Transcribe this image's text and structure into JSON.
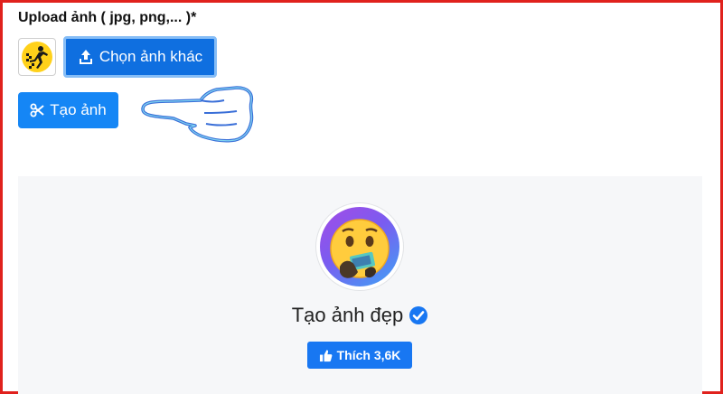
{
  "upload": {
    "label": "Upload ảnh ( jpg, png,... )*",
    "choose_button_label": "Chọn ảnh khác",
    "create_button_label": "Tạo ảnh"
  },
  "preview": {
    "title": "Tạo ảnh đẹp",
    "like_button_label": "Thích 3,6K"
  },
  "colors": {
    "primary": "#1178ea",
    "facebook_blue": "#1877f2",
    "frame_red": "#e0211d",
    "card_bg": "#f6f7f9"
  },
  "icons": {
    "choose": "upload-icon",
    "create": "scissors-icon",
    "verified": "verified-check-icon",
    "like": "thumbs-up-icon",
    "pointer": "pointing-hand-icon"
  }
}
